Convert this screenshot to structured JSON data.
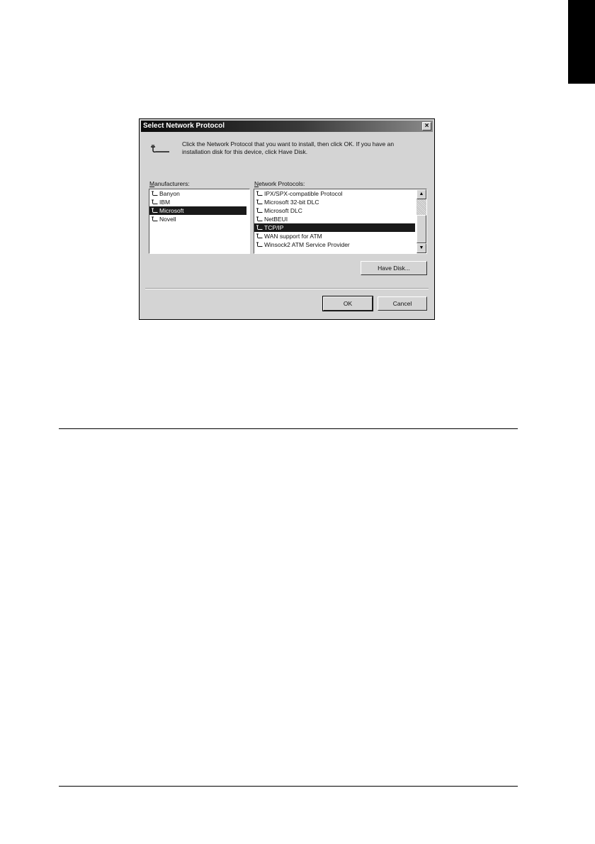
{
  "dialog": {
    "title": "Select Network Protocol",
    "close_glyph": "×",
    "instruction": "Click the Network Protocol that you want to install, then click OK. If you have an installation disk for this device, click Have Disk.",
    "manufacturers_label": "Manufacturers:",
    "protocols_label": "Network Protocols:",
    "manufacturers": [
      {
        "label": "Banyon",
        "selected": false
      },
      {
        "label": "IBM",
        "selected": false
      },
      {
        "label": "Microsoft",
        "selected": true
      },
      {
        "label": "Novell",
        "selected": false
      }
    ],
    "protocols": [
      {
        "label": "IPX/SPX-compatible Protocol",
        "selected": false
      },
      {
        "label": "Microsoft 32-bit DLC",
        "selected": false
      },
      {
        "label": "Microsoft DLC",
        "selected": false
      },
      {
        "label": "NetBEUI",
        "selected": false
      },
      {
        "label": "TCP/IP",
        "selected": true
      },
      {
        "label": "WAN support for ATM",
        "selected": false
      },
      {
        "label": "Winsock2 ATM Service Provider",
        "selected": false
      }
    ],
    "have_disk_label": "Have Disk...",
    "ok_label": "OK",
    "cancel_label": "Cancel",
    "scroll_up_glyph": "▲",
    "scroll_down_glyph": "▼"
  },
  "icons": {
    "protocol": "network-protocol-icon",
    "dialog": "network-cable-icon"
  }
}
